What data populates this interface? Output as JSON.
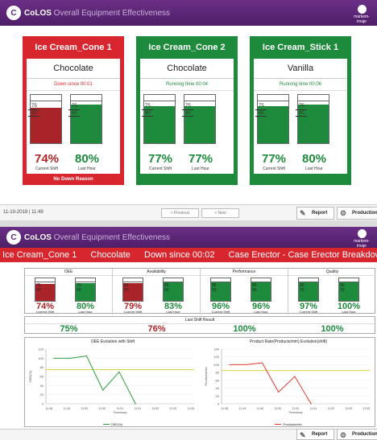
{
  "app": {
    "logo_text": "C",
    "brand": "CoLOS",
    "subtitle": "Overall Equipment Effectiveness",
    "vendor": "markem-imaje"
  },
  "overview": {
    "cards": [
      {
        "name": "Ice Cream_Cone 1",
        "flavor": "Chocolate",
        "status": "Down since 00:01",
        "color": "#d8262f",
        "gauges": [
          {
            "label": "75",
            "label2": "60",
            "fill": 0.74,
            "color": "#a82428"
          },
          {
            "label": "75",
            "label2": "60",
            "fill": 0.8,
            "color": "#1e8a3c"
          }
        ],
        "current_shift": "74%",
        "last_hour": "80%",
        "current_color": "#b02428",
        "last_color": "#1e8a3c",
        "footer": "No Down Reason"
      },
      {
        "name": "Ice Cream_Cone 2",
        "flavor": "Chocolate",
        "status": "Running time 00:04",
        "color": "#1e8a3c",
        "gauges": [
          {
            "label": "75",
            "label2": "60",
            "fill": 0.77,
            "color": "#1e8a3c"
          },
          {
            "label": "75",
            "label2": "60",
            "fill": 0.77,
            "color": "#1e8a3c"
          }
        ],
        "current_shift": "77%",
        "last_hour": "77%",
        "current_color": "#1e8a3c",
        "last_color": "#1e8a3c",
        "footer": ""
      },
      {
        "name": "Ice Cream_Stick 1",
        "flavor": "Vanilla",
        "status": "Running time 00:06",
        "color": "#1e8a3c",
        "gauges": [
          {
            "label": "75",
            "label2": "60",
            "fill": 0.77,
            "color": "#1e8a3c"
          },
          {
            "label": "75",
            "label2": "60",
            "fill": 0.8,
            "color": "#1e8a3c"
          }
        ],
        "current_shift": "77%",
        "last_hour": "80%",
        "current_color": "#1e8a3c",
        "last_color": "#1e8a3c",
        "footer": ""
      }
    ],
    "current_shift_label": "Current Shift",
    "last_hour_label": "Last Hour",
    "date": "11-10-2019 | 11:49",
    "previous": "< Previous",
    "next": "> Next",
    "report": "Report",
    "production": "Production Par"
  },
  "detail": {
    "line": "Ice Cream_Cone 1",
    "flavor": "Chocolate",
    "status": "Down since 00:02",
    "reason": "Case Erector - Case Erector Breakdown",
    "kpis": [
      {
        "title": "OEE",
        "g1": {
          "fill": 0.74,
          "color": "#a82428",
          "l1": "75",
          "l2": "60"
        },
        "g2": {
          "fill": 0.8,
          "color": "#1e8a3c",
          "l1": "75",
          "l2": "60"
        },
        "v1": "74%",
        "v2": "80%",
        "c1": "#b02428",
        "c2": "#1e8a3c"
      },
      {
        "title": "Availability",
        "g1": {
          "fill": 0.79,
          "color": "#a82428",
          "l1": "80",
          "l2": "50"
        },
        "g2": {
          "fill": 0.83,
          "color": "#1e8a3c",
          "l1": "80",
          "l2": "50"
        },
        "v1": "79%",
        "v2": "83%",
        "c1": "#b02428",
        "c2": "#1e8a3c"
      },
      {
        "title": "Performance",
        "g1": {
          "fill": 0.96,
          "color": "#1e8a3c",
          "l1": "85",
          "l2": "50"
        },
        "g2": {
          "fill": 0.96,
          "color": "#1e8a3c",
          "l1": "85",
          "l2": "50"
        },
        "v1": "96%",
        "v2": "96%",
        "c1": "#1e8a3c",
        "c2": "#1e8a3c"
      },
      {
        "title": "Quality",
        "g1": {
          "fill": 0.97,
          "color": "#1e8a3c",
          "l1": "90",
          "l2": "70"
        },
        "g2": {
          "fill": 1.0,
          "color": "#1e8a3c",
          "l1": "90",
          "l2": "70"
        },
        "v1": "97%",
        "v2": "100%",
        "c1": "#1e8a3c",
        "c2": "#1e8a3c"
      }
    ],
    "current_shift_label": "Current Shift",
    "last_hour_label": "Last Hour",
    "last_shift_title": "Last Shift Result",
    "last_shift": [
      {
        "value": "75%",
        "color": "#1e8a3c"
      },
      {
        "value": "76%",
        "color": "#b02428"
      },
      {
        "value": "100%",
        "color": "#1e8a3c"
      },
      {
        "value": "100%",
        "color": "#1e8a3c"
      }
    ],
    "report": "Report",
    "production": "Production Par"
  },
  "chart_data": [
    {
      "type": "line",
      "title": "OEE Evolution with Shift",
      "ylabel": "OEE(%)",
      "xlabel": "Timestamp",
      "ylim": [
        0,
        120
      ],
      "yticks": [
        0,
        20,
        40,
        60,
        80,
        100,
        120
      ],
      "x": [
        "11:48",
        "11:48",
        "11:50",
        "11:50",
        "11:50",
        "11:51",
        "11:51",
        "11:52",
        "11:52",
        "11:53",
        "11:53"
      ],
      "xticks": [
        "11:48",
        "11:49",
        "11:50",
        "11:50",
        "11:51",
        "11:51",
        "11:52",
        "11:52",
        "11:53"
      ],
      "series": [
        {
          "name": "OEE(%)",
          "values": [
            100,
            100,
            105,
            30,
            70,
            0
          ],
          "color": "#2a9d3a"
        }
      ],
      "threshold": 75,
      "threshold_color": "#c9c300"
    },
    {
      "type": "line",
      "title": "Product Rate(Products/min) Evolution(shift)",
      "ylabel": "Products/min",
      "xlabel": "Timestamp",
      "ylim": [
        0,
        140
      ],
      "yticks": [
        0,
        20,
        40,
        60,
        80,
        100,
        120,
        140
      ],
      "xticks": [
        "11:48",
        "11:49",
        "11:50",
        "11:50",
        "11:51",
        "11:51",
        "11:52",
        "11:52",
        "11:53"
      ],
      "series": [
        {
          "name": "Products/min",
          "values": [
            100,
            100,
            105,
            30,
            70,
            0
          ],
          "color": "#e03a2f"
        }
      ],
      "threshold": 85,
      "threshold_color": "#c9c300"
    }
  ]
}
